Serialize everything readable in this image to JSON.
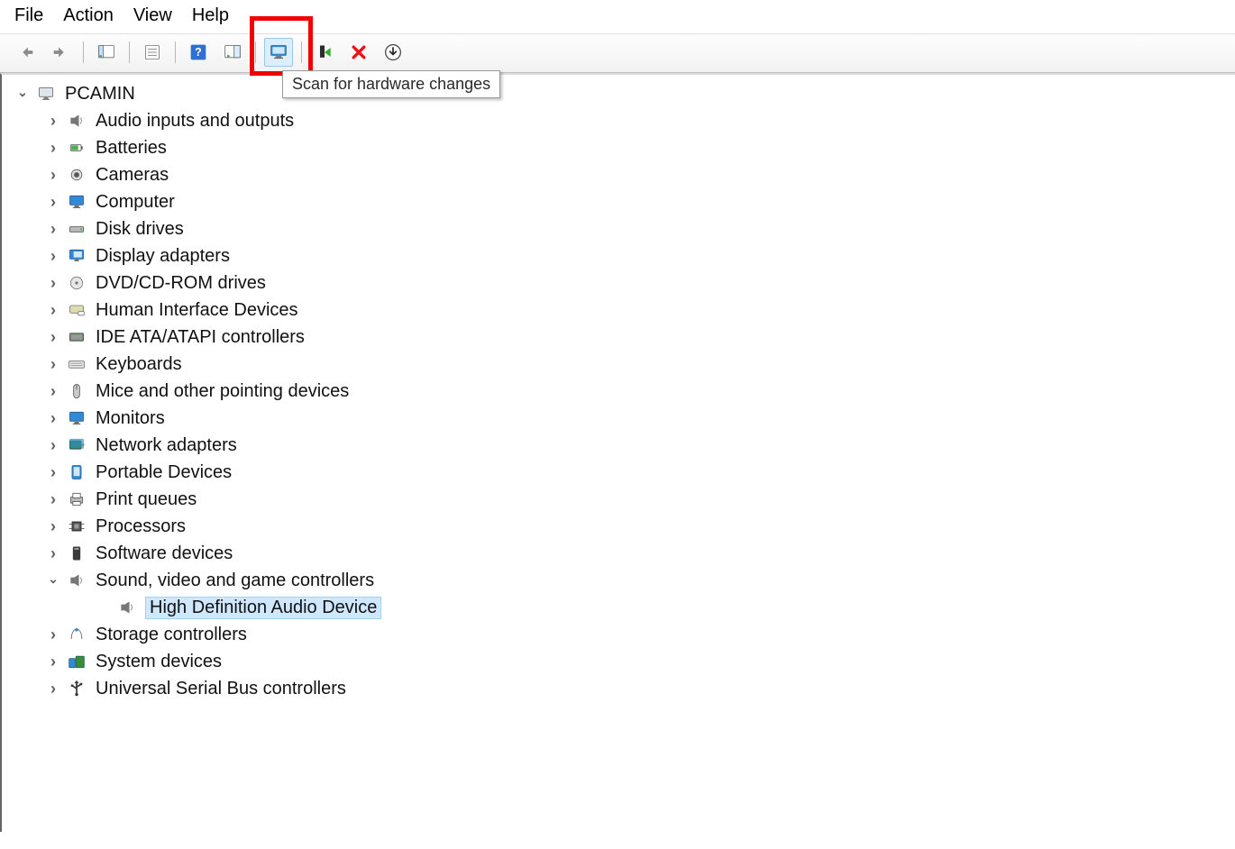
{
  "menubar": {
    "items": [
      "File",
      "Action",
      "View",
      "Help"
    ]
  },
  "tooltip": "Scan for hardware changes",
  "root": {
    "label": "PCAMIN"
  },
  "categories": [
    {
      "label": "Audio inputs and outputs",
      "icon": "speaker"
    },
    {
      "label": "Batteries",
      "icon": "battery"
    },
    {
      "label": "Cameras",
      "icon": "camera"
    },
    {
      "label": "Computer",
      "icon": "monitor"
    },
    {
      "label": "Disk drives",
      "icon": "disk"
    },
    {
      "label": "Display adapters",
      "icon": "display"
    },
    {
      "label": "DVD/CD-ROM drives",
      "icon": "optical"
    },
    {
      "label": "Human Interface Devices",
      "icon": "hid"
    },
    {
      "label": "IDE ATA/ATAPI controllers",
      "icon": "ide"
    },
    {
      "label": "Keyboards",
      "icon": "keyboard"
    },
    {
      "label": "Mice and other pointing devices",
      "icon": "mouse"
    },
    {
      "label": "Monitors",
      "icon": "monitor"
    },
    {
      "label": "Network adapters",
      "icon": "netcard"
    },
    {
      "label": "Portable Devices",
      "icon": "tablet"
    },
    {
      "label": "Print queues",
      "icon": "printer"
    },
    {
      "label": "Processors",
      "icon": "cpu"
    },
    {
      "label": "Software devices",
      "icon": "software"
    },
    {
      "label": "Sound, video and game controllers",
      "icon": "speaker",
      "expanded": true,
      "children": [
        {
          "label": "High Definition Audio Device",
          "icon": "speaker",
          "selected": true
        }
      ]
    },
    {
      "label": "Storage controllers",
      "icon": "storage"
    },
    {
      "label": "System devices",
      "icon": "system"
    },
    {
      "label": "Universal Serial Bus controllers",
      "icon": "usb"
    }
  ]
}
